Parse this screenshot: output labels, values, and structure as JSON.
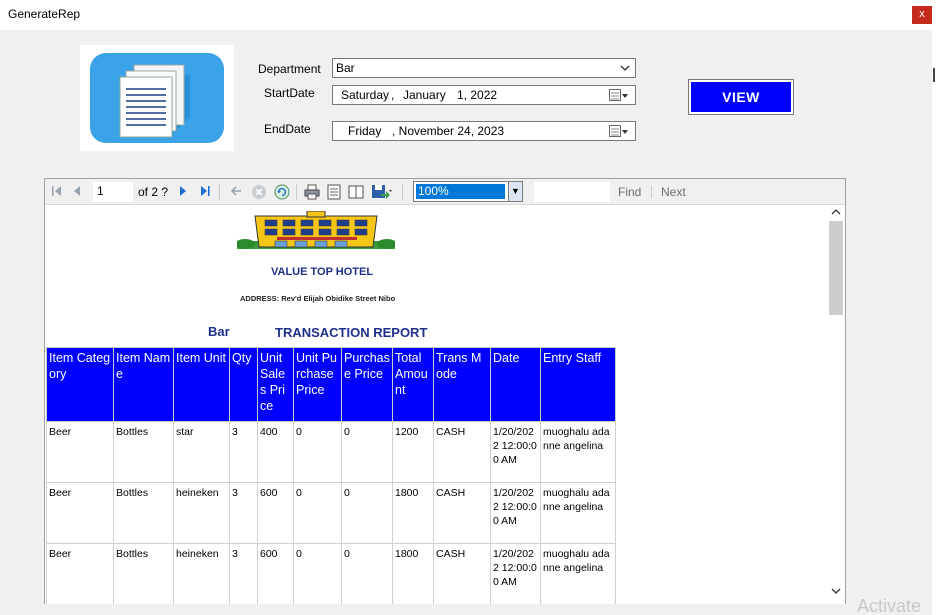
{
  "window": {
    "title": "GenerateRep",
    "close_label": "x"
  },
  "form": {
    "department_label": "Department",
    "department_value": "Bar",
    "startdate_label": "StartDate",
    "start_day": "Saturday",
    "start_sep": ",",
    "start_month": "January",
    "start_rest": "1, 2022",
    "enddate_label": "EndDate",
    "end_day": "Friday",
    "end_rest": ", November 24, 2023",
    "view_button": "VIEW"
  },
  "toolbar": {
    "page_value": "1",
    "of_label": "of  2 ?",
    "zoom_value": "100%",
    "find_label": "Find",
    "next_label": "Next"
  },
  "report": {
    "hotel_name": "VALUE TOP HOTEL",
    "address": "ADDRESS: Rev'd Elijah Obidike Street Nibo",
    "department": "Bar",
    "title": "TRANSACTION REPORT",
    "columns": [
      "Item Category",
      "Item Name",
      "Item Unit",
      "Qty",
      "Unit Sales Price",
      "Unit Purchase Price",
      "Purchase Price",
      "Total Amount",
      "Trans Mode",
      "Date",
      "Entry Staff"
    ],
    "rows": [
      [
        "Beer",
        "Bottles",
        "star",
        "3",
        "400",
        "0",
        "0",
        "1200",
        "CASH",
        "1/20/2022 12:00:00 AM",
        "muoghalu adanne angelina"
      ],
      [
        "Beer",
        "Bottles",
        "heineken",
        "3",
        "600",
        "0",
        "0",
        "1800",
        "CASH",
        "1/20/2022 12:00:00 AM",
        "muoghalu adanne angelina"
      ],
      [
        "Beer",
        "Bottles",
        "heineken",
        "3",
        "600",
        "0",
        "0",
        "1800",
        "CASH",
        "1/20/2022 12:00:00 AM",
        "muoghalu adanne angelina"
      ]
    ]
  },
  "watermark": "Activate",
  "colors": {
    "accent_blue": "#0000ff",
    "report_title": "#1f2f8c",
    "close_red": "#c42b1c",
    "selection": "#0078d7"
  },
  "icons": [
    "document-icon",
    "hotel-logo",
    "first-page-icon",
    "prev-page-icon",
    "next-page-icon",
    "last-page-icon",
    "back-icon",
    "stop-icon",
    "refresh-icon",
    "print-icon",
    "print-layout-icon",
    "page-setup-icon",
    "export-icon",
    "calendar-icon",
    "chevron-down-icon"
  ]
}
